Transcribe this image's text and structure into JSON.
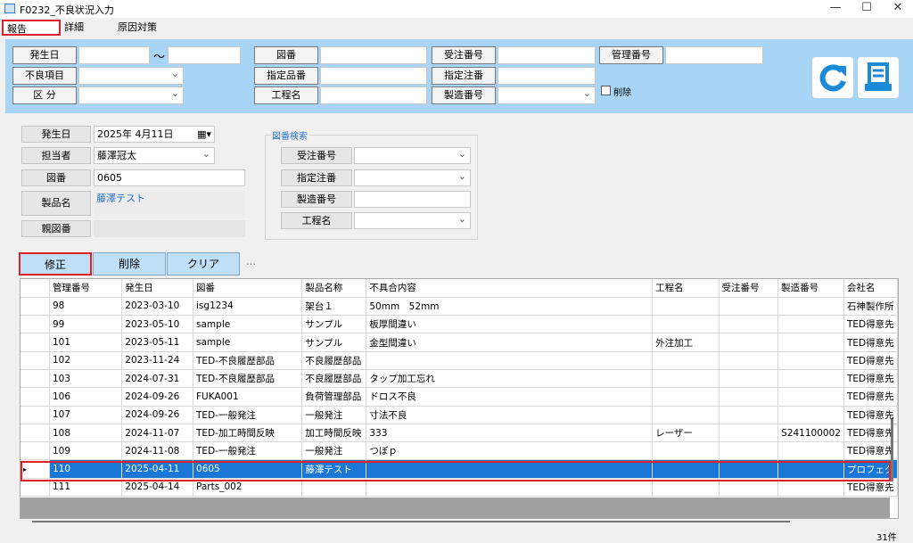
{
  "window": {
    "title": "F0232_不良状況入力"
  },
  "tabs": [
    {
      "label": "報告"
    },
    {
      "label": "詳細"
    },
    {
      "label": "原因対策"
    }
  ],
  "filter": {
    "hassei_label": "発生日",
    "tilde": "～",
    "furyo_label": "不良項目",
    "kubun_label": "区 分",
    "zuban_label": "図番",
    "shitei_hinban_label": "指定品番",
    "koteimei_label": "工程名",
    "juchu_label": "受注番号",
    "shitei_chuban_label": "指定注番",
    "seizo_label": "製造番号",
    "kanri_label": "管理番号",
    "sakujo_label": "削除"
  },
  "form": {
    "hassei_label": "発生日",
    "hassei_value": "2025年 4月11日",
    "tanto_label": "担当者",
    "tanto_value": "藤澤冠太",
    "zuban_label": "図番",
    "zuban_value": "0605",
    "seihin_label": "製品名",
    "seihin_value": "藤澤テスト",
    "oyazuban_label": "親図番"
  },
  "zuban_search": {
    "title": "図番検索",
    "juchu_label": "受注番号",
    "shitei_label": "指定注番",
    "seizo_label": "製造番号",
    "koteimei_label": "工程名"
  },
  "actions": {
    "edit": "修正",
    "delete": "削除",
    "clear": "クリア",
    "more": "…"
  },
  "grid": {
    "columns": [
      "管理番号",
      "発生日",
      "図番",
      "製品名称",
      "不具合内容",
      "工程名",
      "受注番号",
      "製造番号",
      "会社名"
    ],
    "rows": [
      [
        "98",
        "2023-03-10",
        "isg1234",
        "架台１",
        "50mm　52mm",
        "",
        "",
        "",
        "石神製作所"
      ],
      [
        "99",
        "2023-05-10",
        "sample",
        "サンプル",
        "板厚間違い",
        "",
        "",
        "",
        "TED得意先"
      ],
      [
        "101",
        "2023-05-11",
        "sample",
        "サンプル",
        "金型間違い",
        "外注加工",
        "",
        "",
        "TED得意先"
      ],
      [
        "102",
        "2023-11-24",
        "TED-不良履歴部品",
        "不良履歴部品",
        "",
        "",
        "",
        "",
        "TED得意先"
      ],
      [
        "103",
        "2024-07-31",
        "TED-不良履歴部品",
        "不良履歴部品",
        "タップ加工忘れ",
        "",
        "",
        "",
        "TED得意先"
      ],
      [
        "106",
        "2024-09-26",
        "FUKA001",
        "負荷管理部品",
        "ドロス不良",
        "",
        "",
        "",
        "TED得意先"
      ],
      [
        "107",
        "2024-09-26",
        "TED-一般発注",
        "一般発注",
        "寸法不良",
        "",
        "",
        "",
        "TED得意先"
      ],
      [
        "108",
        "2024-11-07",
        "TED-加工時間反映",
        "加工時間反映",
        "333",
        "レーザー",
        "",
        "S241100002",
        "TED得意先"
      ],
      [
        "109",
        "2024-11-08",
        "TED-一般発注",
        "一般発注",
        "つぼｐ",
        "",
        "",
        "",
        "TED得意先"
      ],
      [
        "110",
        "2025-04-11",
        "0605",
        "藤澤テスト",
        "",
        "",
        "",
        "",
        "プロフェク"
      ],
      [
        "111",
        "2025-04-14",
        "Parts_002",
        "",
        "",
        "",
        "",
        "",
        "TED得意先"
      ]
    ],
    "selected_row": 9
  },
  "status": {
    "count": "31件"
  },
  "colors": {
    "band": "#a8d5f5",
    "selection": "#1a77d6",
    "highlight": "#e0202a",
    "icon": "#1b8ad8"
  }
}
